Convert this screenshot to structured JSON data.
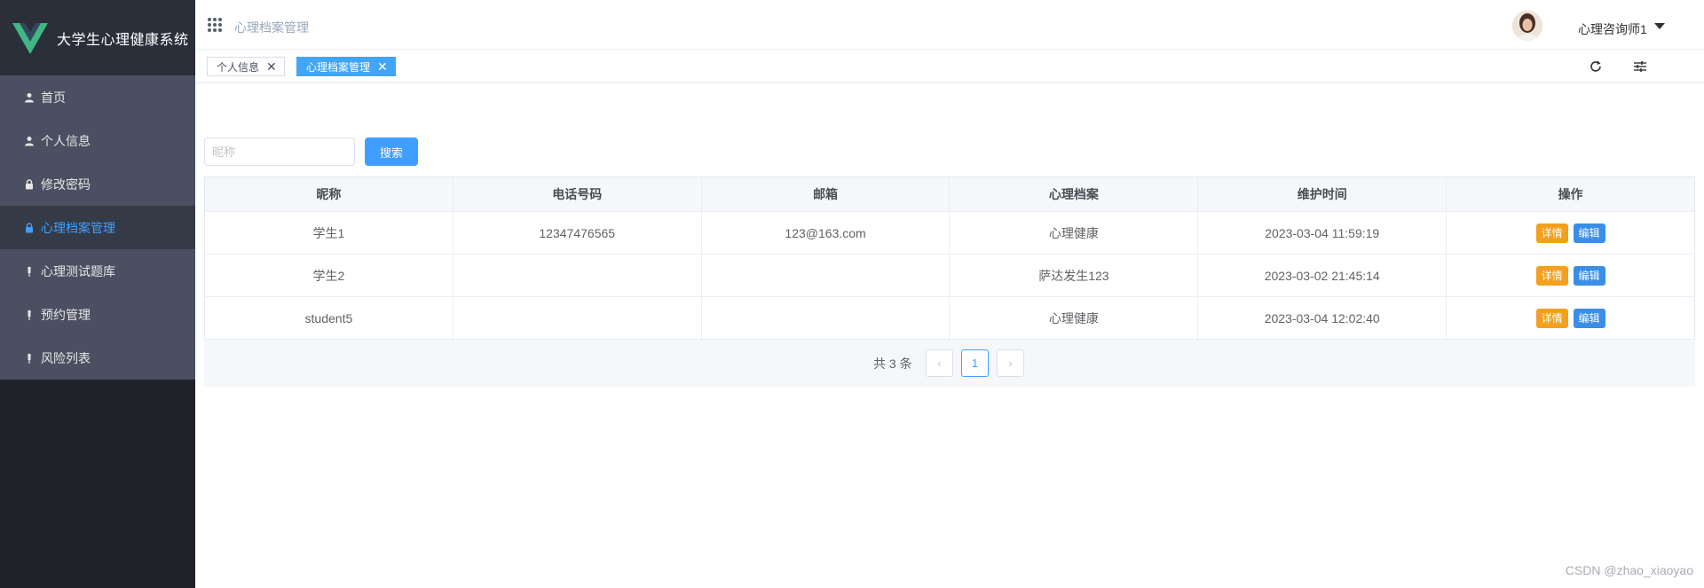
{
  "brand": {
    "title": "大学生心理健康系统"
  },
  "sidebar": {
    "items": [
      {
        "label": "首页",
        "icon": "user-icon",
        "active": false
      },
      {
        "label": "个人信息",
        "icon": "user-icon",
        "active": false
      },
      {
        "label": "修改密码",
        "icon": "lock-icon",
        "active": false
      },
      {
        "label": "心理档案管理",
        "icon": "lock-icon",
        "active": true
      },
      {
        "label": "心理测试题库",
        "icon": "pin-icon",
        "active": false
      },
      {
        "label": "预约管理",
        "icon": "pin-icon",
        "active": false
      },
      {
        "label": "风险列表",
        "icon": "pin-icon",
        "active": false
      }
    ]
  },
  "header": {
    "breadcrumb": "心理档案管理",
    "username": "心理咨询师1"
  },
  "tags": [
    {
      "label": "个人信息",
      "active": false
    },
    {
      "label": "心理档案管理",
      "active": true
    }
  ],
  "search": {
    "placeholder": "昵称",
    "button_label": "搜索"
  },
  "table": {
    "columns": [
      "昵称",
      "电话号码",
      "邮箱",
      "心理档案",
      "维护时间",
      "操作"
    ],
    "rows": [
      [
        "学生1",
        "12347476565",
        "123@163.com",
        "心理健康",
        "2023-03-04 11:59:19"
      ],
      [
        "学生2",
        "",
        "",
        "萨达发生123",
        "2023-03-02 21:45:14"
      ],
      [
        "student5",
        "",
        "",
        "心理健康",
        "2023-03-04 12:02:40"
      ]
    ],
    "actions": {
      "detail": "详情",
      "edit": "编辑"
    }
  },
  "pagination": {
    "total_text": "共 3 条",
    "current_page": "1"
  },
  "colors": {
    "accent": "#409eff",
    "warning": "#f3a01d",
    "sidebar_bg": "#1f2229",
    "menu_bg": "#4a5061"
  },
  "watermark": "CSDN @zhao_xiaoyao"
}
